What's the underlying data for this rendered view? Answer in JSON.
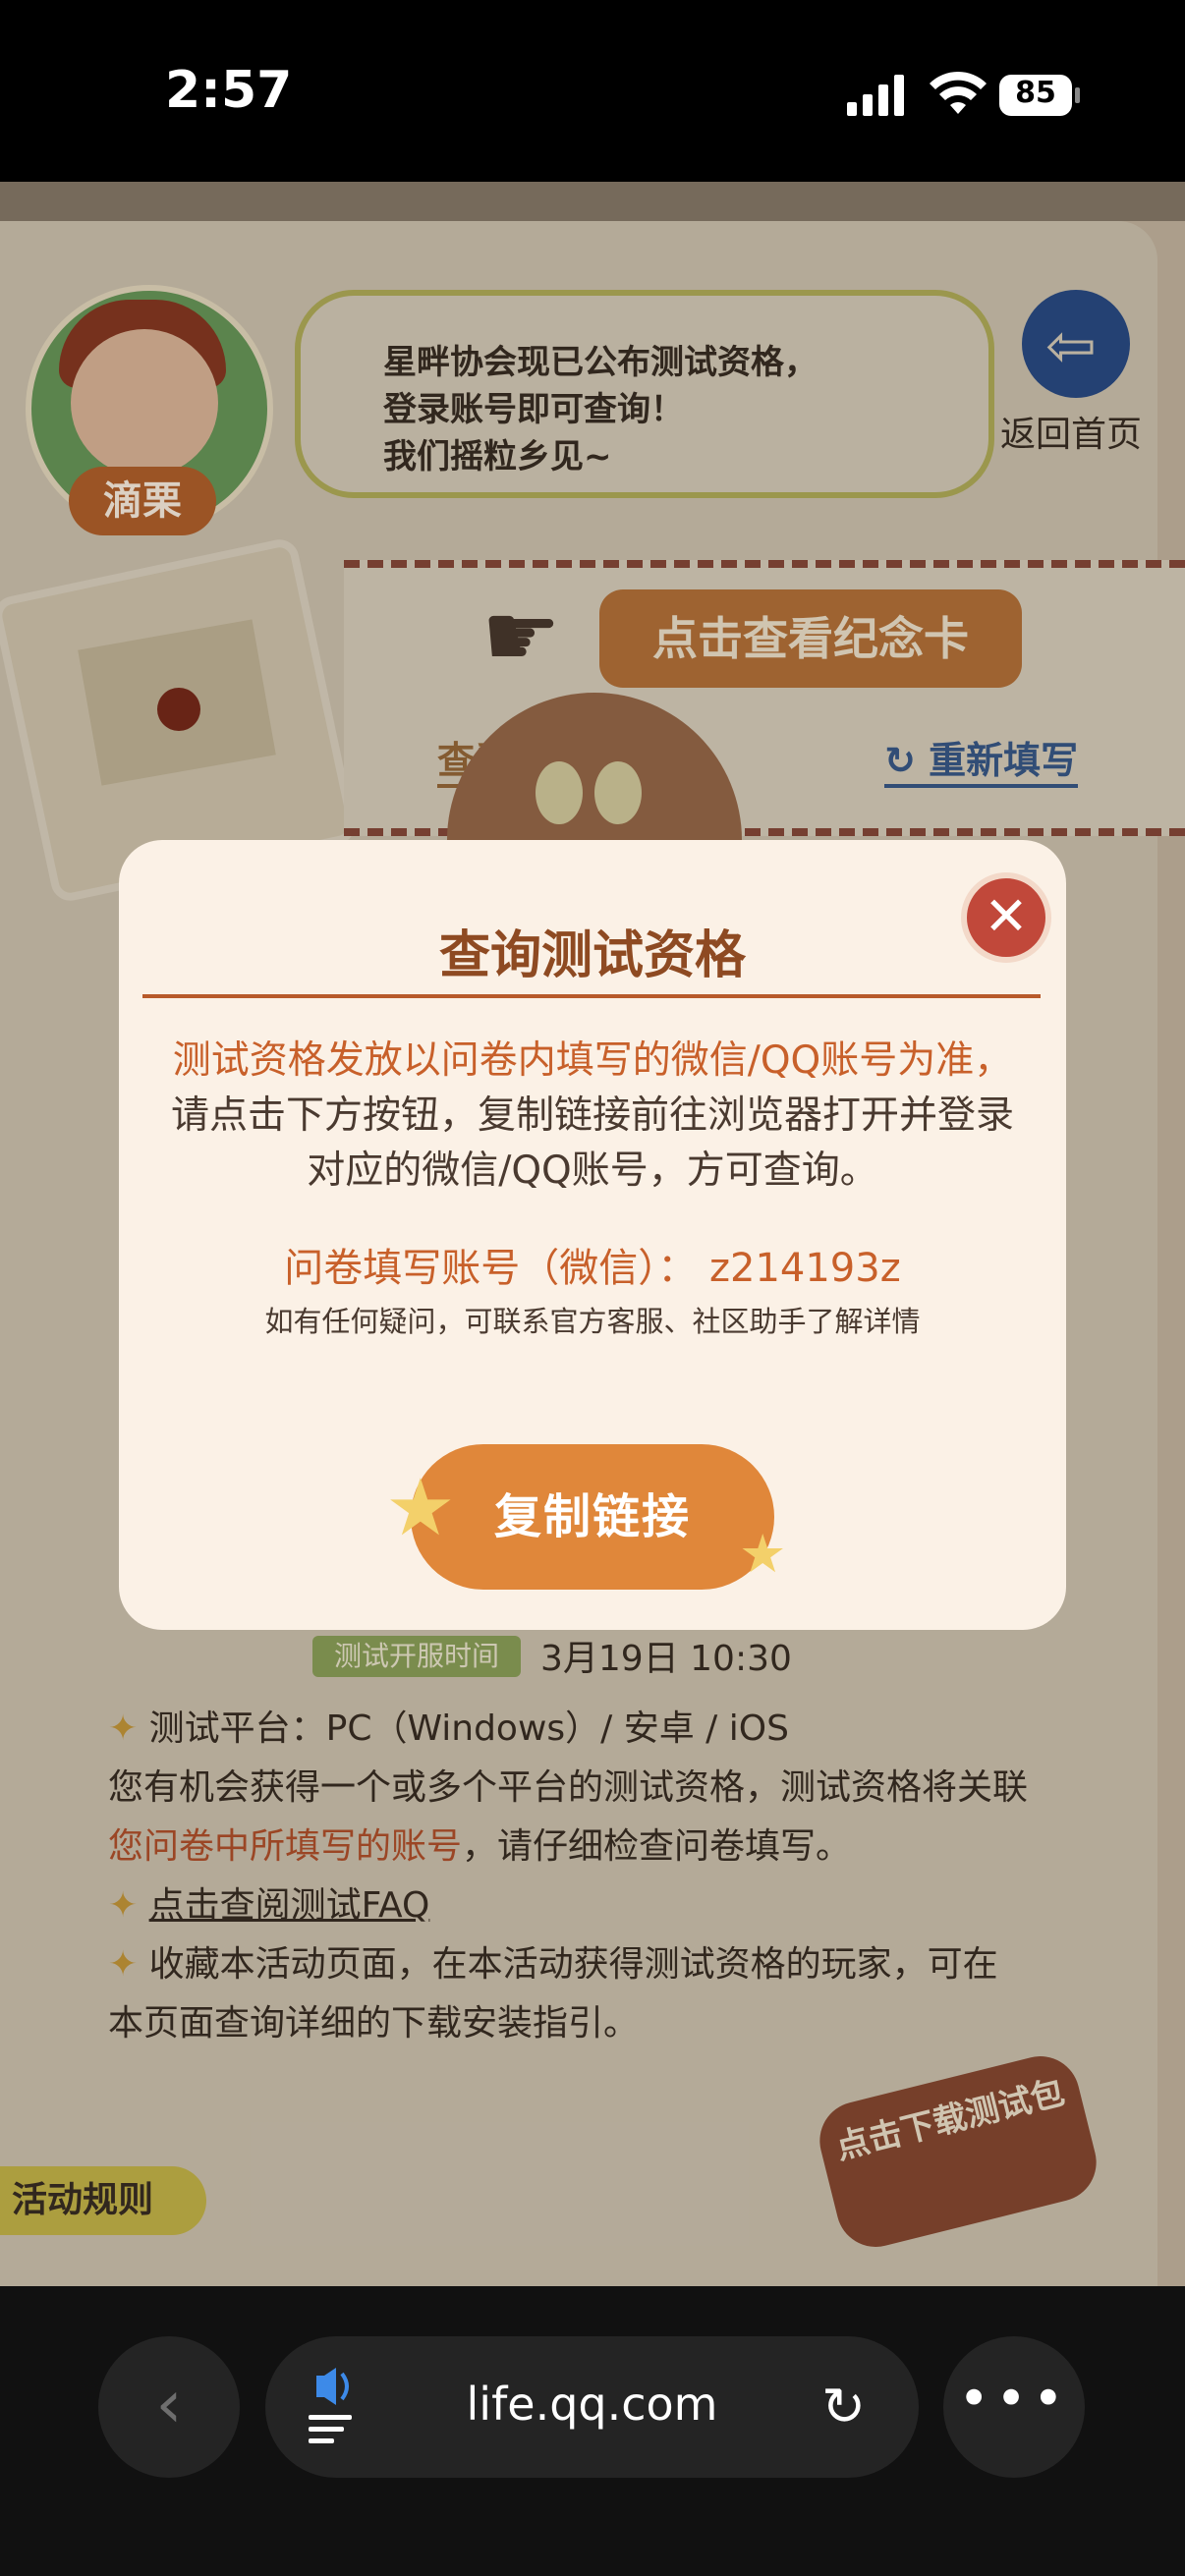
{
  "status_bar": {
    "time": "2:57",
    "battery": "85"
  },
  "page": {
    "character_name": "滴栗",
    "bubble_lines": [
      "星畔协会现已公布测试资格，",
      "登录账号即可查询！",
      "我们摇粒乡见~"
    ],
    "home_label": "返回首页",
    "memorial_button": "点击查看纪念卡",
    "link_view": "查看填写记录",
    "link_refill": "重新填写",
    "test_time_badge": "测试开服时间",
    "test_time_value": "3月19日  10:30",
    "rules": {
      "platform": "测试平台：PC（Windows）/ 安卓 / iOS",
      "chance_pre": "您有机会获得一个或多个平台的测试资格，测试资格将关联",
      "chance_highlight": "您问卷中所填写的账号",
      "chance_post": "，请仔细检查问卷填写。",
      "faq_link": "点击查阅测试FAQ",
      "bookmark": "收藏本活动页面，在本活动获得测试资格的玩家，可在本页面查询详细的下载安装指引。"
    },
    "activity_rules_tag": "活动规则",
    "download_badge": "点击下载测试包"
  },
  "modal": {
    "title": "查询测试资格",
    "body_accent": "测试资格发放以问卷内填写的微信/QQ账号为准，",
    "body_rest": "请点击下方按钮，复制链接前往浏览器打开并登录对应的微信/QQ账号，方可查询。",
    "account_line": "问卷填写账号（微信）：  z214193z",
    "hint": "如有任何疑问，可联系官方客服、社区助手了解详情",
    "copy_button": "复制链接",
    "close_symbol": "✕"
  },
  "browser": {
    "url": "life.qq.com"
  },
  "icons": {
    "back": "chevron-left-icon",
    "reload": "reload-icon",
    "more": "more-icon",
    "speaker": "speaker-icon",
    "home": "home-arrow-icon"
  },
  "colors": {
    "accent": "#c8602a",
    "modal_bg": "#fbf1e6",
    "close": "#c1483a",
    "button": "#e0873a"
  }
}
